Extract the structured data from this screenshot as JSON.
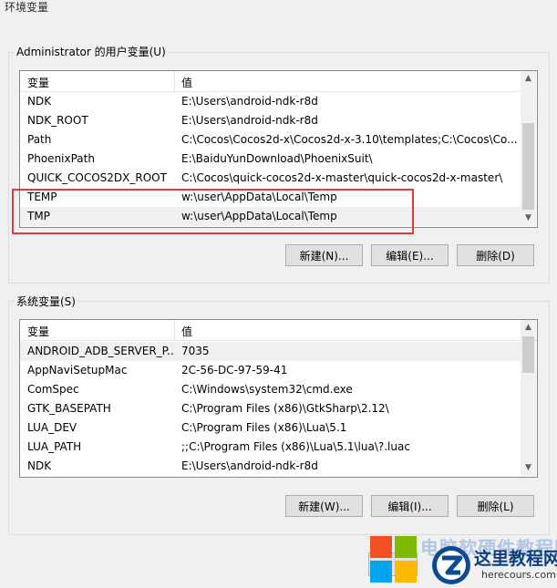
{
  "window": {
    "title": "环境变量"
  },
  "user_vars": {
    "group_label": "Administrator 的用户变量(U)",
    "columns": [
      "变量",
      "值"
    ],
    "rows": [
      {
        "name": "NDK",
        "value": "E:\\Users\\android-ndk-r8d"
      },
      {
        "name": "NDK_ROOT",
        "value": "E:\\Users\\android-ndk-r8d"
      },
      {
        "name": "Path",
        "value": "C:\\Cocos\\Cocos2d-x\\Cocos2d-x-3.10\\templates;C:\\Cocos\\Co..."
      },
      {
        "name": "PhoenixPath",
        "value": "E:\\BaiduYunDownload\\PhoenixSuit\\"
      },
      {
        "name": "QUICK_COCOS2DX_ROOT",
        "value": "C:\\Cocos\\quick-cocos2d-x-master\\quick-cocos2d-x-master\\"
      },
      {
        "name": "TEMP",
        "value": "w:\\user\\AppData\\Local\\Temp"
      },
      {
        "name": "TMP",
        "value": "w:\\user\\AppData\\Local\\Temp"
      }
    ],
    "buttons": {
      "new": "新建(N)...",
      "edit": "编辑(E)...",
      "delete": "删除(D)"
    }
  },
  "system_vars": {
    "group_label": "系统变量(S)",
    "columns": [
      "变量",
      "值"
    ],
    "rows": [
      {
        "name": "ANDROID_ADB_SERVER_P...",
        "value": "7035"
      },
      {
        "name": "AppNaviSetupMac",
        "value": "2C-56-DC-97-59-41"
      },
      {
        "name": "ComSpec",
        "value": "C:\\Windows\\system32\\cmd.exe"
      },
      {
        "name": "GTK_BASEPATH",
        "value": "C:\\Program Files (x86)\\GtkSharp\\2.12\\"
      },
      {
        "name": "LUA_DEV",
        "value": "C:\\Program Files (x86)\\Lua\\5.1"
      },
      {
        "name": "LUA_PATH",
        "value": ";;C:\\Program Files (x86)\\Lua\\5.1\\lua\\?.luac"
      },
      {
        "name": "NDK",
        "value": "E:\\Users\\android-ndk-r8d"
      }
    ],
    "buttons": {
      "new": "新建(W)...",
      "edit": "编辑(I)...",
      "delete": "删除(L)"
    }
  },
  "watermark": {
    "site_name": "这里教程网",
    "site_url": "herecours.com",
    "overlay_text": "电脑软硬件教程网"
  },
  "colors": {
    "highlight_box": "#e23b3b",
    "alt_row": "#f0f0f0"
  }
}
